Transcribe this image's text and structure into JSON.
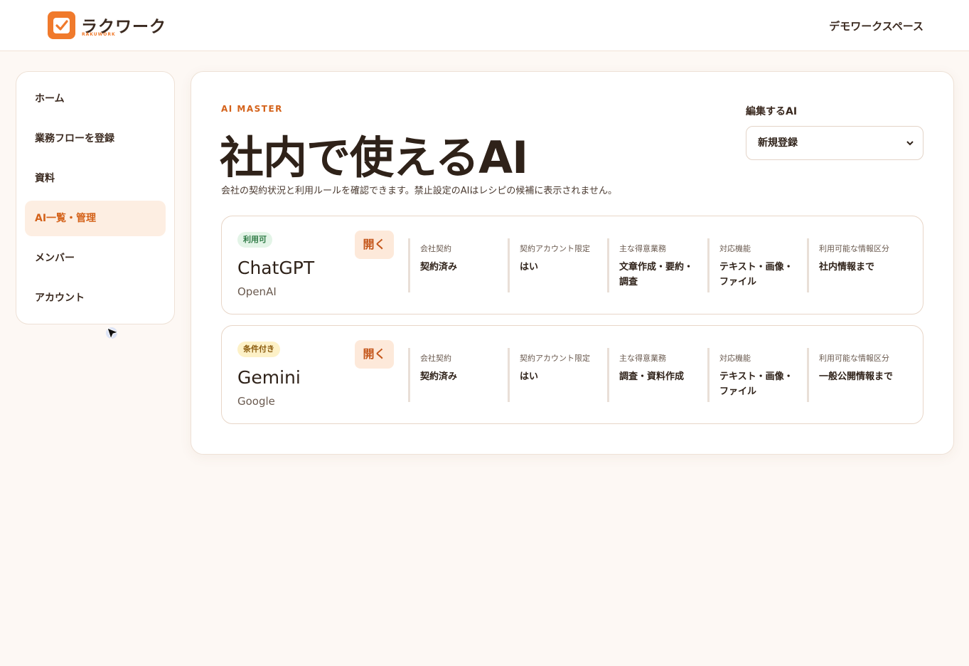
{
  "header": {
    "brand_name": "ラクワーク",
    "brand_sub": "RAKUWORK",
    "workspace": "デモワークスペース"
  },
  "sidebar": {
    "items": [
      {
        "label": "ホーム"
      },
      {
        "label": "業務フローを登録"
      },
      {
        "label": "資料"
      },
      {
        "label": "AI一覧・管理"
      },
      {
        "label": "メンバー"
      },
      {
        "label": "アカウント"
      }
    ],
    "active_index": 3
  },
  "main": {
    "eyebrow": "AI MASTER",
    "title": "社内で使えるAI",
    "subtitle": "会社の契約状況と利用ルールを確認できます。禁止設定のAIはレシピの候補に表示されません。",
    "select_label": "編集するAI",
    "select_value": "新規登録",
    "attr_labels": [
      "会社契約",
      "契約アカウント限定",
      "主な得意業務",
      "対応機能",
      "利用可能な情報区分"
    ],
    "open_label": "開く",
    "cards": [
      {
        "badge": "利用可",
        "name": "ChatGPT",
        "vendor": "OpenAI",
        "values": [
          "契約済み",
          "はい",
          "文章作成・要約・調査",
          "テキスト・画像・ファイル",
          "社内情報まで"
        ]
      },
      {
        "badge": "条件付き",
        "name": "Gemini",
        "vendor": "Google",
        "values": [
          "契約済み",
          "はい",
          "調査・資料作成",
          "テキスト・画像・ファイル",
          "一般公開情報まで"
        ]
      }
    ]
  },
  "colors": {
    "accent": "#f07a2c",
    "accent_text": "#d4621a",
    "background": "#fdf8f4",
    "badge_ok": "#2e7a45",
    "badge_cond": "#8a5a0c"
  }
}
